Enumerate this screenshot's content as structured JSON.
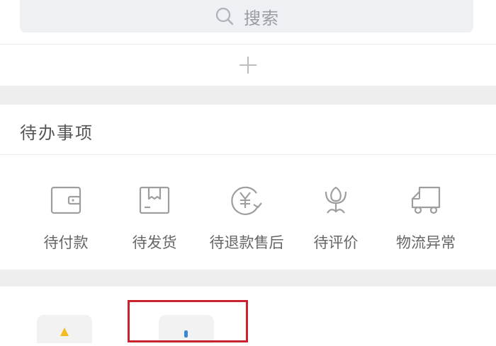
{
  "search": {
    "placeholder": "搜索",
    "icon": "search-icon"
  },
  "add_button": {
    "icon": "plus-icon"
  },
  "todo_section": {
    "title": "待办事项",
    "items": [
      {
        "label": "待付款",
        "icon": "wallet-icon"
      },
      {
        "label": "待发货",
        "icon": "package-icon"
      },
      {
        "label": "待退款售后",
        "icon": "refund-yen-icon"
      },
      {
        "label": "待评价",
        "icon": "flower-review-icon"
      },
      {
        "label": "物流异常",
        "icon": "truck-icon"
      }
    ]
  },
  "colors": {
    "highlight": "#c8232c",
    "band": "#eeeeee",
    "search_bg": "#eef0f4"
  }
}
